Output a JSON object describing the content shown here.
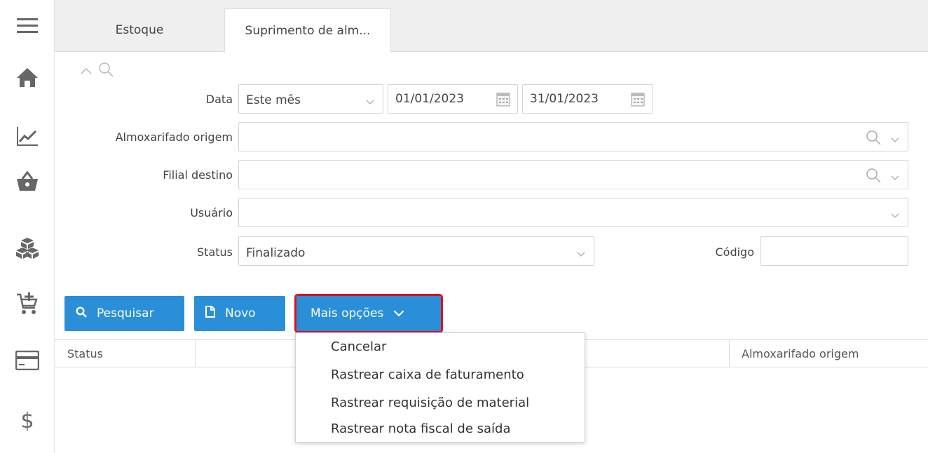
{
  "sidebar": {
    "icons": [
      "menu-icon",
      "home-icon",
      "chart-icon",
      "basket-icon",
      "boxes-icon",
      "cart-add-icon",
      "card-icon",
      "dollar-icon"
    ],
    "dollar_glyph": "$"
  },
  "tabs": [
    {
      "label": "Estoque",
      "active": false
    },
    {
      "label": "Suprimento de alm...",
      "active": true
    }
  ],
  "filters": {
    "data": {
      "label": "Data",
      "period": "Este mês",
      "start": "01/01/2023",
      "end": "31/01/2023"
    },
    "almoxarifado_origem": {
      "label": "Almoxarifado origem",
      "value": ""
    },
    "filial_destino": {
      "label": "Filial destino",
      "value": ""
    },
    "usuario": {
      "label": "Usuário",
      "value": ""
    },
    "status": {
      "label": "Status",
      "value": "Finalizado"
    },
    "codigo": {
      "label": "Código",
      "value": ""
    }
  },
  "actions": {
    "search": "Pesquisar",
    "new": "Novo",
    "more": "Mais opções"
  },
  "table": {
    "columns": [
      "Status",
      "Almoxarifado origem"
    ]
  },
  "more_menu": {
    "items": [
      "Cancelar",
      "Rastrear caixa de faturamento",
      "Rastrear requisição de material",
      "Rastrear nota fiscal de saída"
    ]
  },
  "colors": {
    "primary": "#2a8fd8",
    "highlight": "#e0101a"
  }
}
